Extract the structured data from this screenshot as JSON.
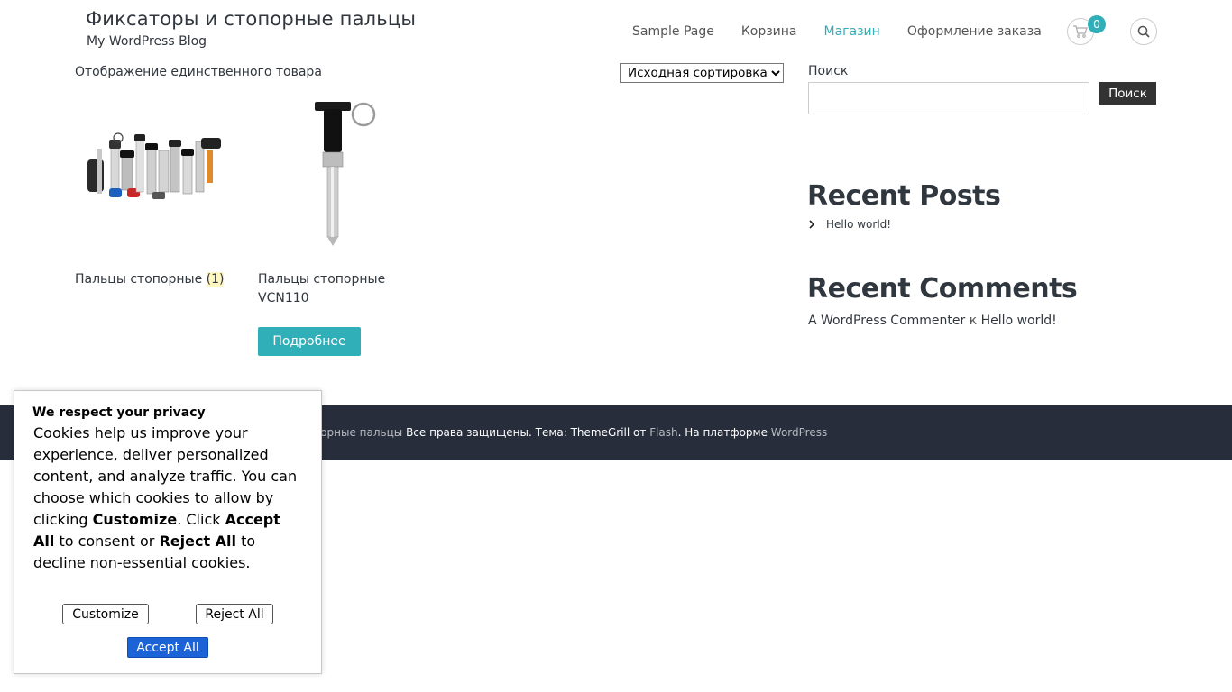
{
  "header": {
    "site_title": "Фиксаторы и стопорные пальцы",
    "site_description": "My WordPress Blog",
    "nav": [
      {
        "label": "Sample Page",
        "active": false
      },
      {
        "label": "Корзина",
        "active": false
      },
      {
        "label": "Магазин",
        "active": true
      },
      {
        "label": "Оформление заказа",
        "active": false
      }
    ],
    "cart_count": "0",
    "cart_icon": "cart-icon",
    "search_icon": "search-icon"
  },
  "shop": {
    "result_count": "Отображение единственного товара",
    "orderby_selected": "Исходная сортировка",
    "category": {
      "title": "Пальцы стопорные",
      "count": "(1)"
    },
    "product": {
      "title": "Пальцы стопорные VCN110",
      "button": "Подробнее"
    }
  },
  "sidebar": {
    "search_label": "Поиск",
    "search_button": "Поиск",
    "recent_posts_title": "Recent Posts",
    "recent_posts": [
      "Hello world!"
    ],
    "recent_comments_title": "Recent Comments",
    "comment_author": "A WordPress Commenter",
    "comment_sep": "к",
    "comment_post": "Hello world!"
  },
  "footer": {
    "site_link": "опорные пальцы",
    "rights": " Все права защищены. Тема: ThemeGrill от ",
    "theme_link": "Flash",
    "platform": ". На платформе ",
    "wp_link": "WordPress"
  },
  "cookie": {
    "title": "We respect your privacy",
    "text_1": "Cookies help us improve your experience, deliver personalized content, and analyze traffic. You can choose which cookies to allow by clicking ",
    "customize_bold": "Customize",
    "text_2": ". Click ",
    "accept_bold": "Accept All",
    "text_3": " to consent or ",
    "reject_bold": "Reject All",
    "text_4": " to decline non-essential cookies.",
    "btn_customize": "Customize",
    "btn_reject": "Reject All",
    "btn_accept": "Accept All"
  },
  "colors": {
    "accent": "#30afb8",
    "footer_bg": "#272d3b",
    "accept_button": "#1b63d6"
  }
}
